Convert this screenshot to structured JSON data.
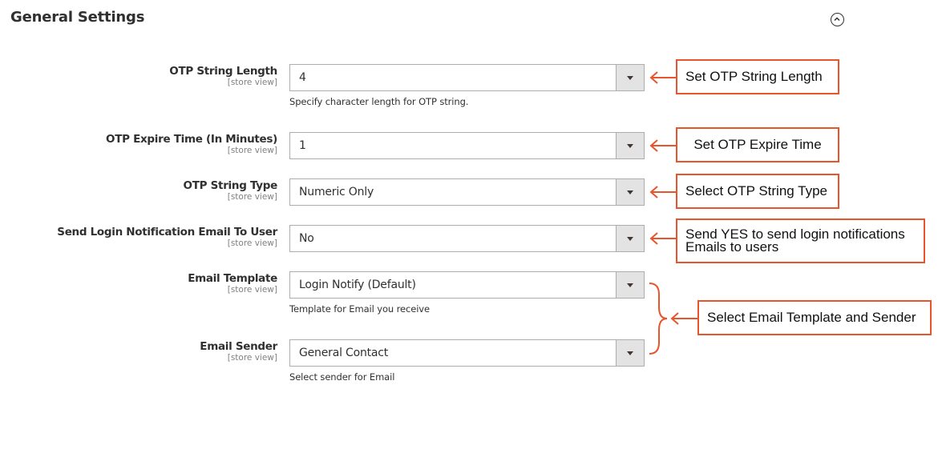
{
  "header": {
    "title": "General Settings",
    "collapse_icon": "chevron-up-circle-icon"
  },
  "fields": [
    {
      "label": "OTP String Length",
      "scope": "[store view]",
      "value": "4",
      "note": "Specify character length for OTP string."
    },
    {
      "label": "OTP Expire Time (In Minutes)",
      "scope": "[store view]",
      "value": "1",
      "note": ""
    },
    {
      "label": "OTP String Type",
      "scope": "[store view]",
      "value": "Numeric Only",
      "note": ""
    },
    {
      "label": "Send Login Notification Email To User",
      "scope": "[store view]",
      "value": "No",
      "note": ""
    },
    {
      "label": "Email Template",
      "scope": "[store view]",
      "value": "Login Notify (Default)",
      "note": "Template for Email you receive"
    },
    {
      "label": "Email Sender",
      "scope": "[store view]",
      "value": "General Contact",
      "note": "Select sender for Email"
    }
  ],
  "callouts": [
    {
      "text": "Set OTP String Length"
    },
    {
      "text": "Set OTP Expire Time"
    },
    {
      "text": "Select OTP String Type"
    },
    {
      "line1": "Send YES to send login notifications",
      "line2": "Emails to users"
    },
    {
      "text": "Select Email Template and Sender"
    }
  ],
  "colors": {
    "callout_accent": "#e8542b",
    "arrow_button_bg": "#e3e3e3",
    "text": "#303030",
    "scope_text": "#808080"
  }
}
